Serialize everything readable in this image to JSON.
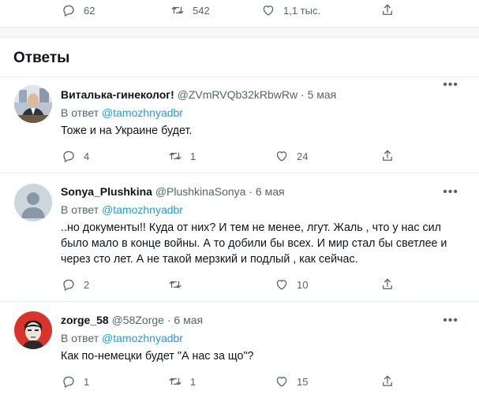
{
  "top_actions": {
    "reply_count": "62",
    "retweet_count": "542",
    "like_count": "1,1 тыс."
  },
  "section_title": "Ответы",
  "replies": [
    {
      "username": "Виталька-гинеколог!",
      "handle": "@ZVmRVQb32kRbwRw",
      "date": "5 мая",
      "reply_prefix": "В ответ",
      "reply_to": "@tamozhnyadbr",
      "text": "Тоже и на Украине будет.",
      "replies": "4",
      "retweets": "1",
      "likes": "24"
    },
    {
      "username": "Sonya_Plushkina",
      "handle": "@PlushkinaSonya",
      "date": "6 мая",
      "reply_prefix": "В ответ",
      "reply_to": "@tamozhnyadbr",
      "text": "..но документы!! Куда от них? И тем не менее, лгут. Жаль , что у нас сил было мало в конце войны. А то добили бы всех. И мир стал  бы светлее и через сто лет. А не такой мерзкий и подлый , как сейчас.",
      "replies": "2",
      "retweets": "",
      "likes": "10"
    },
    {
      "username": "zorge_58",
      "handle": "@58Zorge",
      "date": "6 мая",
      "reply_prefix": "В ответ",
      "reply_to": "@tamozhnyadbr",
      "text": "Как по-немецки будет \"А нас за що\"?",
      "replies": "1",
      "retweets": "1",
      "likes": "15"
    }
  ],
  "colors": {
    "link": "#1d9bf0",
    "secondary": "#536471",
    "divider": "#e6ecf0"
  },
  "icons": [
    "reply-icon",
    "retweet-icon",
    "like-icon",
    "share-icon",
    "more-icon"
  ]
}
